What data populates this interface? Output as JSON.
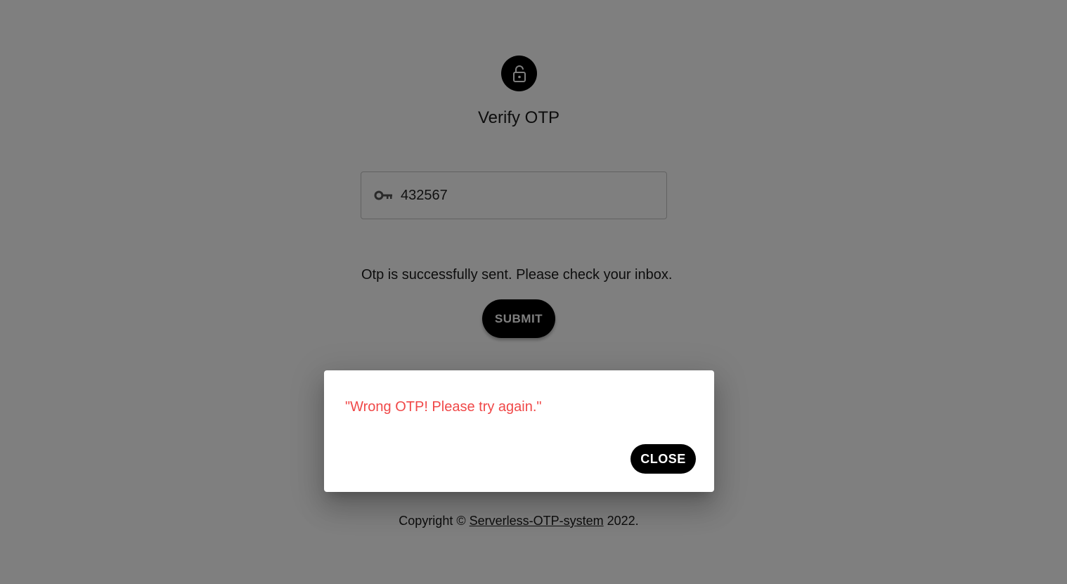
{
  "page": {
    "title": "Verify OTP",
    "lock_icon": "lock-open-icon",
    "otp_field": {
      "icon": "key-icon",
      "value": "432567"
    },
    "status_message": "Otp is successfully sent. Please check your inbox.",
    "submit_label": "SUBMIT",
    "footer": {
      "prefix": "Copyright © ",
      "link_text": "Serverless-OTP-system",
      "suffix": " 2022."
    }
  },
  "dialog": {
    "message": "\"Wrong OTP! Please try again.\"",
    "close_label": "CLOSE",
    "message_color": "#f04848"
  },
  "colors": {
    "primary": "#000000",
    "backdrop": "rgba(0,0,0,0.5)"
  }
}
